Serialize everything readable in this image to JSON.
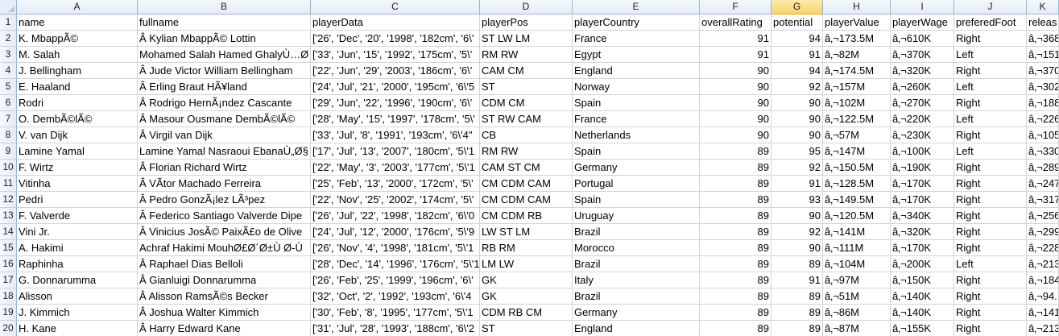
{
  "spreadsheet": {
    "column_letters": [
      "A",
      "B",
      "C",
      "D",
      "E",
      "F",
      "G",
      "H",
      "I",
      "J",
      "K"
    ],
    "selected_column": "G",
    "row_numbers": [
      "1",
      "2",
      "3",
      "4",
      "5",
      "6",
      "7",
      "8",
      "9",
      "10",
      "11",
      "12",
      "13",
      "14",
      "15",
      "16",
      "17",
      "18",
      "19",
      "20"
    ],
    "rows": [
      [
        "name",
        "fullname",
        "playerData",
        "playerPos",
        "playerCountry",
        "overallRating",
        "potential",
        "playerValue",
        "playerWage",
        "preferedFoot",
        "releas"
      ],
      [
        "K. MbappÃ©",
        "Â Kylian MbappÃ© Lottin",
        "['26', 'Dec', '20', '1998', '182cm', '6\\'",
        "ST LW LM",
        "France",
        "91",
        "94",
        "â‚¬173.5M",
        "â‚¬610K",
        "Right",
        "â‚¬368"
      ],
      [
        "M. Salah",
        "Mohamed Salah Hamed GhalyÙ…Ø",
        "['33', 'Jun', '15', '1992', '175cm', '5\\'",
        "RM RW",
        "Egypt",
        "91",
        "91",
        "â‚¬82M",
        "â‚¬370K",
        "Left",
        "â‚¬151"
      ],
      [
        "J. Bellingham",
        "Â Jude Victor William Bellingham",
        "['22', 'Jun', '29', '2003', '186cm', '6\\'",
        "CAM CM",
        "England",
        "90",
        "94",
        "â‚¬174.5M",
        "â‚¬320K",
        "Right",
        "â‚¬370"
      ],
      [
        "E. Haaland",
        "Â Erling Braut HÃ¥land",
        "['24', 'Jul', '21', '2000', '195cm', '6\\'5",
        "ST",
        "Norway",
        "90",
        "92",
        "â‚¬157M",
        "â‚¬260K",
        "Left",
        "â‚¬302"
      ],
      [
        "Rodri",
        "Â Rodrigo HernÃ¡ndez Cascante",
        "['29', 'Jun', '22', '1996', '190cm', '6\\'",
        "CDM CM",
        "Spain",
        "90",
        "90",
        "â‚¬102M",
        "â‚¬270K",
        "Right",
        "â‚¬188"
      ],
      [
        "O. DembÃ©lÃ©",
        "Â Masour Ousmane DembÃ©lÃ©",
        "['28', 'May', '15', '1997', '178cm', '5\\'",
        "ST RW CAM",
        "France",
        "90",
        "90",
        "â‚¬122.5M",
        "â‚¬220K",
        "Left",
        "â‚¬226"
      ],
      [
        "V. van Dijk",
        "Â Virgil van Dijk",
        "['33', 'Jul', '8', '1991', '193cm', '6\\'4\"",
        "CB",
        "Netherlands",
        "90",
        "90",
        "â‚¬57M",
        "â‚¬230K",
        "Right",
        "â‚¬105"
      ],
      [
        "Lamine Yamal",
        "Lamine Yamal Nasraoui EbanaÙ„Ø§",
        "['17', 'Jul', '13', '2007', '180cm', '5\\'1",
        "RM RW",
        "Spain",
        "89",
        "95",
        "â‚¬147M",
        "â‚¬100K",
        "Left",
        "â‚¬330"
      ],
      [
        "F. Wirtz",
        "Â Florian Richard Wirtz",
        "['22', 'May', '3', '2003', '177cm', '5\\'1",
        "CAM ST CM",
        "Germany",
        "89",
        "92",
        "â‚¬150.5M",
        "â‚¬190K",
        "Right",
        "â‚¬289"
      ],
      [
        "Vitinha",
        "Â VÃ­tor Machado Ferreira",
        "['25', 'Feb', '13', '2000', '172cm', '5\\'",
        "CM CDM CAM",
        "Portugal",
        "89",
        "91",
        "â‚¬128.5M",
        "â‚¬170K",
        "Right",
        "â‚¬247"
      ],
      [
        "Pedri",
        "Â Pedro GonzÃ¡lez LÃ³pez",
        "['22', 'Nov', '25', '2002', '174cm', '5\\'",
        "CM CDM CAM",
        "Spain",
        "89",
        "93",
        "â‚¬149.5M",
        "â‚¬170K",
        "Right",
        "â‚¬317"
      ],
      [
        "F. Valverde",
        "Â Federico Santiago Valverde Dipe",
        "['26', 'Jul', '22', '1998', '182cm', '6\\'0",
        "CM CDM RB",
        "Uruguay",
        "89",
        "90",
        "â‚¬120.5M",
        "â‚¬340K",
        "Right",
        "â‚¬256"
      ],
      [
        "Vini Jr.",
        "Â Vinicius JosÃ© PaixÃ£o de Olive",
        "['24', 'Jul', '12', '2000', '176cm', '5\\'9",
        "LW ST LM",
        "Brazil",
        "89",
        "92",
        "â‚¬141M",
        "â‚¬320K",
        "Right",
        "â‚¬299"
      ],
      [
        "A. Hakimi",
        "Achraf Hakimi MouhØ£Ø´Ø±Ù Ø-Ù",
        "['26', 'Nov', '4', '1998', '181cm', '5\\'1",
        "RB RM",
        "Morocco",
        "89",
        "90",
        "â‚¬111M",
        "â‚¬170K",
        "Right",
        "â‚¬228"
      ],
      [
        "Raphinha",
        "Â Raphael Dias Belloli",
        "['28', 'Dec', '14', '1996', '176cm', '5\\'1",
        "LM LW",
        "Brazil",
        "89",
        "89",
        "â‚¬104M",
        "â‚¬200K",
        "Left",
        "â‚¬213"
      ],
      [
        "G. Donnarumma",
        "Â Gianluigi Donnarumma",
        "['26', 'Feb', '25', '1999', '196cm', '6\\'",
        "GK",
        "Italy",
        "89",
        "91",
        "â‚¬97M",
        "â‚¬150K",
        "Right",
        "â‚¬184"
      ],
      [
        "Alisson",
        "Â Alisson RamsÃ©s Becker",
        "['32', 'Oct', '2', '1992', '193cm', '6\\'4",
        "GK",
        "Brazil",
        "89",
        "89",
        "â‚¬51M",
        "â‚¬140K",
        "Right",
        "â‚¬94."
      ],
      [
        "J. Kimmich",
        "Â Joshua Walter Kimmich",
        "['30', 'Feb', '8', '1995', '177cm', '5\\'1",
        "CDM RB CM",
        "Germany",
        "89",
        "89",
        "â‚¬86M",
        "â‚¬140K",
        "Right",
        "â‚¬141"
      ],
      [
        "H. Kane",
        "Â Harry Edward Kane",
        "['31', 'Jul', '28', '1993', '188cm', '6\\'2",
        "ST",
        "England",
        "89",
        "89",
        "â‚¬87M",
        "â‚¬155K",
        "Right",
        "â‚¬213"
      ]
    ],
    "numeric_columns": [
      5,
      6
    ]
  }
}
